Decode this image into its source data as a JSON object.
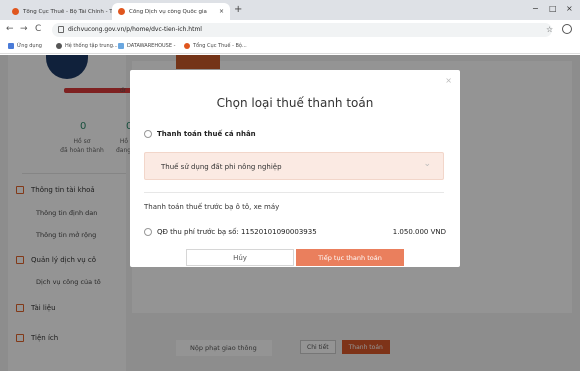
{
  "browser": {
    "tabs": [
      {
        "title": "Tổng Cục Thuế - Bộ Tài Chính - T"
      },
      {
        "title": "Cổng Dịch vụ công Quốc gia"
      }
    ],
    "new_tab": "+",
    "window_controls": [
      "−",
      "□",
      "×"
    ],
    "url": "dichvucong.gov.vn/p/home/dvc-tien-ich.html",
    "bookmarks": [
      "Ứng dụng",
      "Hệ thống tập trung...",
      "DATAWAREHOUSE -",
      "Tổng Cục Thuế - Bộ..."
    ]
  },
  "background": {
    "partial_name": "dr",
    "stats": [
      {
        "num": "0",
        "label1": "Hồ sơ",
        "label2": "đã hoàn thành"
      },
      {
        "num": "0",
        "label1": "Hồ",
        "label2": "đang"
      }
    ],
    "menu": [
      {
        "label": "Thông tin tài khoả"
      },
      {
        "label": "Quản lý dịch vụ cô"
      },
      {
        "label": "Tài liệu"
      },
      {
        "label": "Tiện ích"
      }
    ],
    "submenu": [
      "Thông tin định dan",
      "Thông tin mở rộng",
      "Dịch vụ công của tô"
    ],
    "row_text": "Nộp phạt giao thông",
    "buttons": [
      "Chi tiết",
      "Thanh toán"
    ]
  },
  "modal": {
    "close": "×",
    "title": "Chọn loại thuế thanh toán",
    "option1_label": "Thanh toán thuế cá nhân",
    "select_value": "Thuế sử dụng đất phi nông nghiệp",
    "section_label": "Thanh toán thuế trước bạ ô tô, xe máy",
    "option2_label": "QĐ thu phí trước bạ số: 11520101090003935",
    "option2_amount": "1.050.000 VND",
    "cancel_label": "Hủy",
    "continue_label": "Tiếp tục thanh toán"
  }
}
